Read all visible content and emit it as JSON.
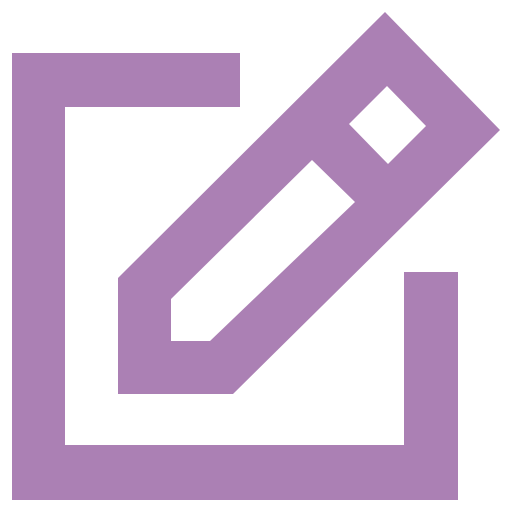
{
  "icon": {
    "name": "edit-icon",
    "color": "#ab80b4"
  }
}
